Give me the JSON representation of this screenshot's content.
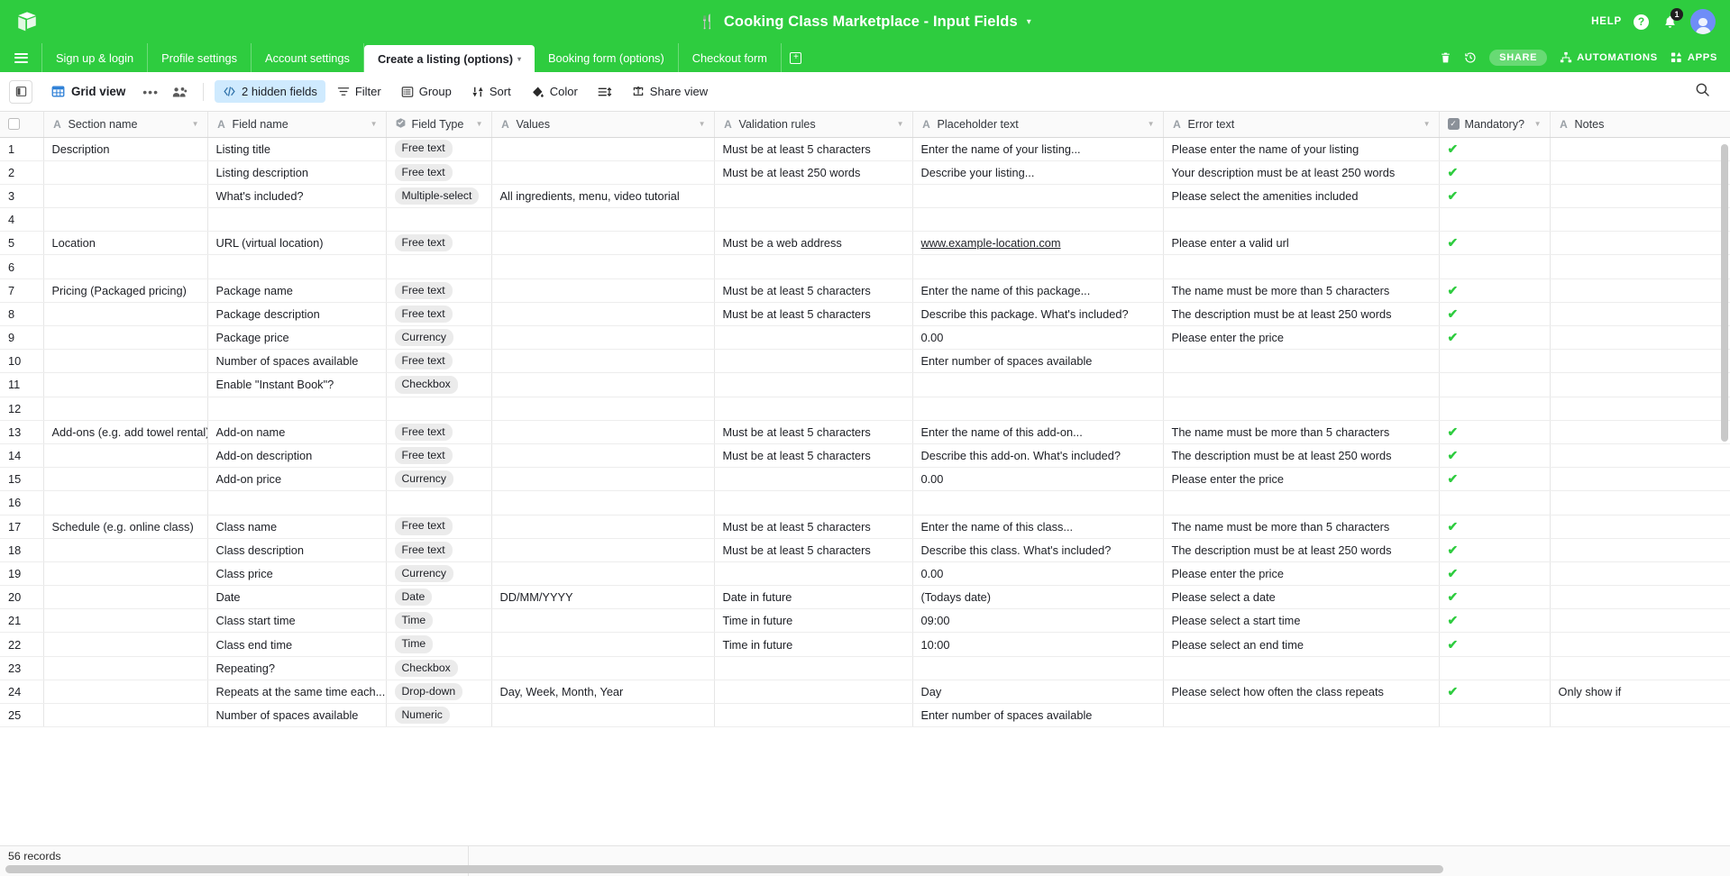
{
  "header": {
    "logo_icon": "airtable-logo-icon",
    "base_title": "Cooking Class Marketplace - Input Fields",
    "base_title_icon": "cutlery-icon",
    "base_title_caret": "▾",
    "help_label": "HELP",
    "help_icon": "question-circle-icon",
    "notification_icon": "bell-icon",
    "notification_count": "1",
    "avatar_icon": "user-avatar"
  },
  "tabs": {
    "menu_icon": "hamburger-icon",
    "items": [
      {
        "label": "Sign up & login",
        "active": false
      },
      {
        "label": "Profile settings",
        "active": false
      },
      {
        "label": "Account settings",
        "active": false
      },
      {
        "label": "Create a listing (options)",
        "active": true,
        "caret": "▾"
      },
      {
        "label": "Booking form (options)",
        "active": false
      },
      {
        "label": "Checkout form",
        "active": false
      }
    ],
    "add_label": "+",
    "right_actions": [
      {
        "name": "trash-icon",
        "label": ""
      },
      {
        "name": "history-icon",
        "label": ""
      },
      {
        "name": "share-button",
        "label": "SHARE"
      },
      {
        "name": "automations-button",
        "label": "AUTOMATIONS"
      },
      {
        "name": "apps-button",
        "label": "APPS"
      }
    ]
  },
  "toolbar": {
    "sidepanel_icon": "side-panel-icon",
    "view_name": "Grid view",
    "view_icon": "grid-icon",
    "dots_label": "•••",
    "collaborators_icon": "collaborators-icon",
    "hidden_fields": "2 hidden fields",
    "filter": "Filter",
    "group": "Group",
    "sort": "Sort",
    "color": "Color",
    "row_height_icon": "row-height-icon",
    "share_view": "Share view",
    "search_icon": "search-icon"
  },
  "grid": {
    "columns": [
      {
        "label": "Section name",
        "icon": "A",
        "caret": true
      },
      {
        "label": "Field name",
        "icon": "A",
        "caret": true
      },
      {
        "label": "Field Type",
        "icon": "select-icon",
        "caret": true
      },
      {
        "label": "Values",
        "icon": "A",
        "caret": true
      },
      {
        "label": "Validation rules",
        "icon": "A",
        "caret": true
      },
      {
        "label": "Placeholder text",
        "icon": "A",
        "caret": true
      },
      {
        "label": "Error text",
        "icon": "A",
        "caret": true
      },
      {
        "label": "Mandatory?",
        "icon": "checkbox-icon",
        "caret": true
      },
      {
        "label": "Notes",
        "icon": "A",
        "caret": false
      }
    ],
    "rows": [
      {
        "n": "1",
        "section": "Description",
        "field": "Listing title",
        "type": "Free text",
        "values": "",
        "validation": "Must be at least 5 characters",
        "placeholder": "Enter the name of your listing...",
        "error": "Please enter the name of your listing",
        "mandatory": true,
        "notes": ""
      },
      {
        "n": "2",
        "section": "",
        "field": "Listing description",
        "type": "Free text",
        "values": "",
        "validation": "Must be at least 250 words",
        "placeholder": "Describe your listing...",
        "error": "Your description must be at least 250 words",
        "mandatory": true,
        "notes": ""
      },
      {
        "n": "3",
        "section": "",
        "field": "What's included?",
        "type": "Multiple-select",
        "values": "All ingredients, menu, video tutorial",
        "validation": "",
        "placeholder": "",
        "error": "Please select the amenities included",
        "mandatory": true,
        "notes": ""
      },
      {
        "n": "4",
        "section": "",
        "field": "",
        "type": "",
        "values": "",
        "validation": "",
        "placeholder": "",
        "error": "",
        "mandatory": false,
        "notes": ""
      },
      {
        "n": "5",
        "section": "Location",
        "field": "URL (virtual location)",
        "type": "Free text",
        "values": "",
        "validation": "Must be a web address",
        "placeholder": "www.example-location.com",
        "error": "Please enter a valid url",
        "mandatory": true,
        "notes": "",
        "placeholder_link": true
      },
      {
        "n": "6",
        "section": "",
        "field": "",
        "type": "",
        "values": "",
        "validation": "",
        "placeholder": "",
        "error": "",
        "mandatory": false,
        "notes": ""
      },
      {
        "n": "7",
        "section": "Pricing (Packaged pricing)",
        "field": "Package name",
        "type": "Free text",
        "values": "",
        "validation": "Must be at least 5 characters",
        "placeholder": "Enter the name of this package...",
        "error": "The name must be more than 5 characters",
        "mandatory": true,
        "notes": ""
      },
      {
        "n": "8",
        "section": "",
        "field": "Package description",
        "type": "Free text",
        "values": "",
        "validation": "Must be at least 5 characters",
        "placeholder": "Describe this package. What's included?",
        "error": "The description must be at least 250 words",
        "mandatory": true,
        "notes": ""
      },
      {
        "n": "9",
        "section": "",
        "field": "Package price",
        "type": "Currency",
        "values": "",
        "validation": "",
        "placeholder": "0.00",
        "error": "Please enter the price",
        "mandatory": true,
        "notes": ""
      },
      {
        "n": "10",
        "section": "",
        "field": "Number of spaces available",
        "type": "Free text",
        "values": "",
        "validation": "",
        "placeholder": "Enter number of spaces available",
        "error": "",
        "mandatory": false,
        "notes": ""
      },
      {
        "n": "11",
        "section": "",
        "field": "Enable \"Instant Book\"?",
        "type": "Checkbox",
        "values": "",
        "validation": "",
        "placeholder": "",
        "error": "",
        "mandatory": false,
        "notes": ""
      },
      {
        "n": "12",
        "section": "",
        "field": "",
        "type": "",
        "values": "",
        "validation": "",
        "placeholder": "",
        "error": "",
        "mandatory": false,
        "notes": ""
      },
      {
        "n": "13",
        "section": "Add-ons (e.g. add towel rental)",
        "field": "Add-on name",
        "type": "Free text",
        "values": "",
        "validation": "Must be at least 5 characters",
        "placeholder": "Enter the name of this add-on...",
        "error": "The name must be more than 5 characters",
        "mandatory": true,
        "notes": ""
      },
      {
        "n": "14",
        "section": "",
        "field": "Add-on description",
        "type": "Free text",
        "values": "",
        "validation": "Must be at least 5 characters",
        "placeholder": "Describe this add-on. What's included?",
        "error": "The description must be at least 250 words",
        "mandatory": true,
        "notes": ""
      },
      {
        "n": "15",
        "section": "",
        "field": "Add-on price",
        "type": "Currency",
        "values": "",
        "validation": "",
        "placeholder": "0.00",
        "error": "Please enter the price",
        "mandatory": true,
        "notes": ""
      },
      {
        "n": "16",
        "section": "",
        "field": "",
        "type": "",
        "values": "",
        "validation": "",
        "placeholder": "",
        "error": "",
        "mandatory": false,
        "notes": ""
      },
      {
        "n": "17",
        "section": "Schedule (e.g. online class)",
        "field": "Class name",
        "type": "Free text",
        "values": "",
        "validation": "Must be at least 5 characters",
        "placeholder": "Enter the name of this class...",
        "error": "The name must be more than 5 characters",
        "mandatory": true,
        "notes": ""
      },
      {
        "n": "18",
        "section": "",
        "field": "Class description",
        "type": "Free text",
        "values": "",
        "validation": "Must be at least 5 characters",
        "placeholder": "Describe this class. What's included?",
        "error": "The description must be at least 250 words",
        "mandatory": true,
        "notes": ""
      },
      {
        "n": "19",
        "section": "",
        "field": "Class price",
        "type": "Currency",
        "values": "",
        "validation": "",
        "placeholder": "0.00",
        "error": "Please enter the price",
        "mandatory": true,
        "notes": ""
      },
      {
        "n": "20",
        "section": "",
        "field": "Date",
        "type": "Date",
        "values": "DD/MM/YYYY",
        "validation": "Date in future",
        "placeholder": "(Todays date)",
        "error": "Please select a date",
        "mandatory": true,
        "notes": ""
      },
      {
        "n": "21",
        "section": "",
        "field": "Class start time",
        "type": "Time",
        "values": "",
        "validation": "Time in future",
        "placeholder": "09:00",
        "error": "Please select a start time",
        "mandatory": true,
        "notes": ""
      },
      {
        "n": "22",
        "section": "",
        "field": "Class end time",
        "type": "Time",
        "values": "",
        "validation": "Time in future",
        "placeholder": "10:00",
        "error": "Please select an end time",
        "mandatory": true,
        "notes": ""
      },
      {
        "n": "23",
        "section": "",
        "field": "Repeating?",
        "type": "Checkbox",
        "values": "",
        "validation": "",
        "placeholder": "",
        "error": "",
        "mandatory": false,
        "notes": ""
      },
      {
        "n": "24",
        "section": "",
        "field": "Repeats at the same time each...",
        "type": "Drop-down",
        "values": "Day, Week, Month, Year",
        "validation": "",
        "placeholder": "Day",
        "error": "Please select how often the class repeats",
        "mandatory": true,
        "notes": "Only show if"
      },
      {
        "n": "25",
        "section": "",
        "field": "Number of spaces available",
        "type": "Numeric",
        "values": "",
        "validation": "",
        "placeholder": "Enter number of spaces available",
        "error": "",
        "mandatory": false,
        "notes": ""
      }
    ]
  },
  "footer": {
    "record_count": "56 records"
  },
  "colors": {
    "brand_green": "#2ecc3f",
    "check_green": "#2ecc3f",
    "hidden_fields_bg": "#cfeafe",
    "avatar_blue": "#6f8df7"
  }
}
